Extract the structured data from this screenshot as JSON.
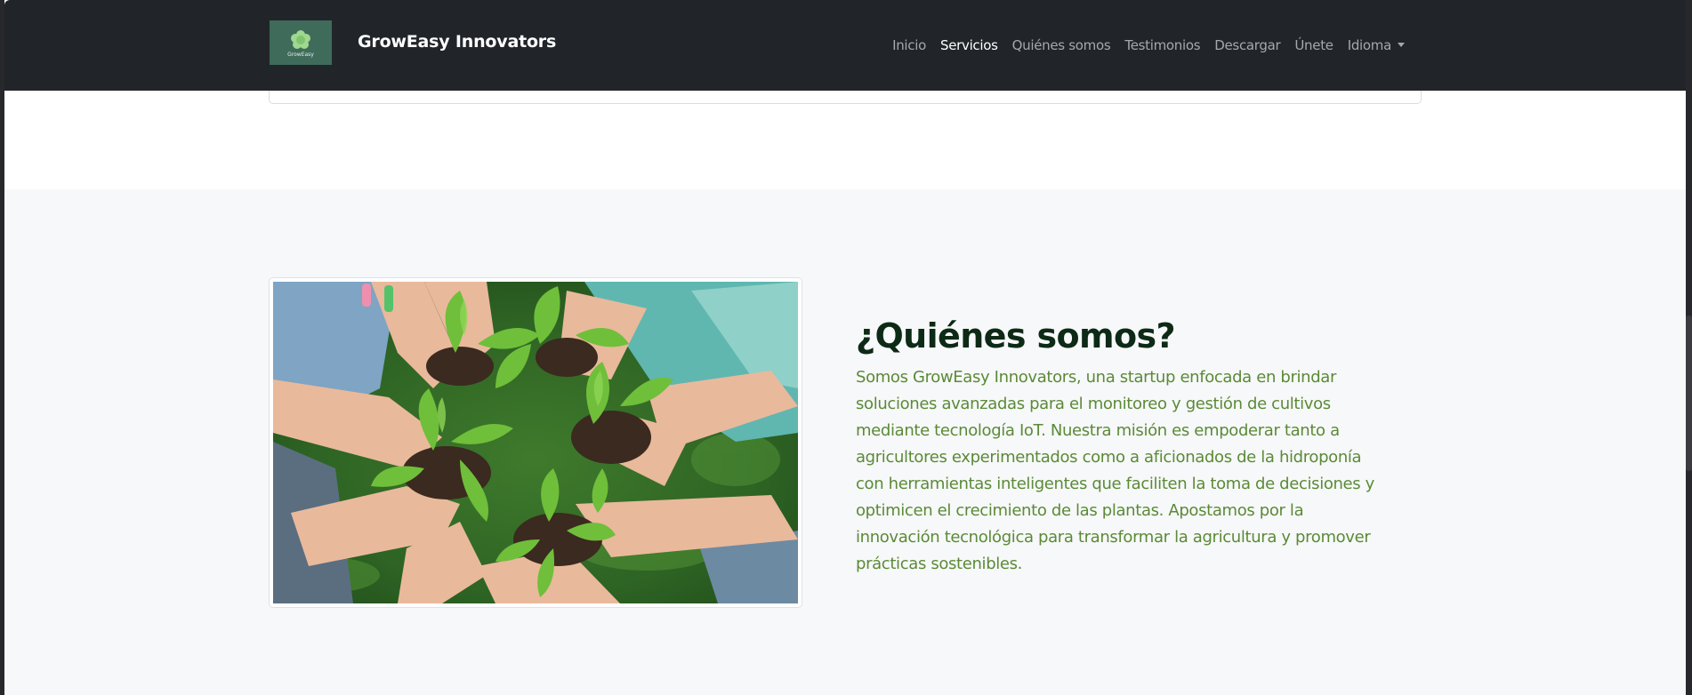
{
  "navbar": {
    "brand_name": "GrowEasy Innovators",
    "logo_text": "GrowEasy",
    "links": [
      {
        "label": "Inicio",
        "active": false
      },
      {
        "label": "Servicios",
        "active": true
      },
      {
        "label": "Quiénes somos",
        "active": false
      },
      {
        "label": "Testimonios",
        "active": false
      },
      {
        "label": "Descargar",
        "active": false
      },
      {
        "label": "Únete",
        "active": false
      },
      {
        "label": "Idioma",
        "active": false,
        "dropdown": true
      }
    ]
  },
  "about": {
    "title": "¿Quiénes somos?",
    "body": "Somos GrowEasy Innovators, una startup enfocada en brindar soluciones avanzadas para el monitoreo y gestión de cultivos mediante tecnología IoT. Nuestra misión es empoderar tanto a agricultores experimentados como a aficionados de la hidroponía con herramientas inteligentes que faciliten la toma de decisiones y optimicen el crecimiento de las plantas. Apostamos por la innovación tecnológica para transformar la agricultura y promover prácticas sostenibles.",
    "image_icon": "hands-holding-seedlings-photo"
  },
  "colors": {
    "navbar_bg": "#212529",
    "section_bg": "#f7f8f9",
    "title_color": "#0d2a16",
    "body_color": "#5a8a37",
    "nav_active": "#ffffff",
    "nav_inactive": "#a5a8ab",
    "logo_bg": "#3f6b5b"
  }
}
